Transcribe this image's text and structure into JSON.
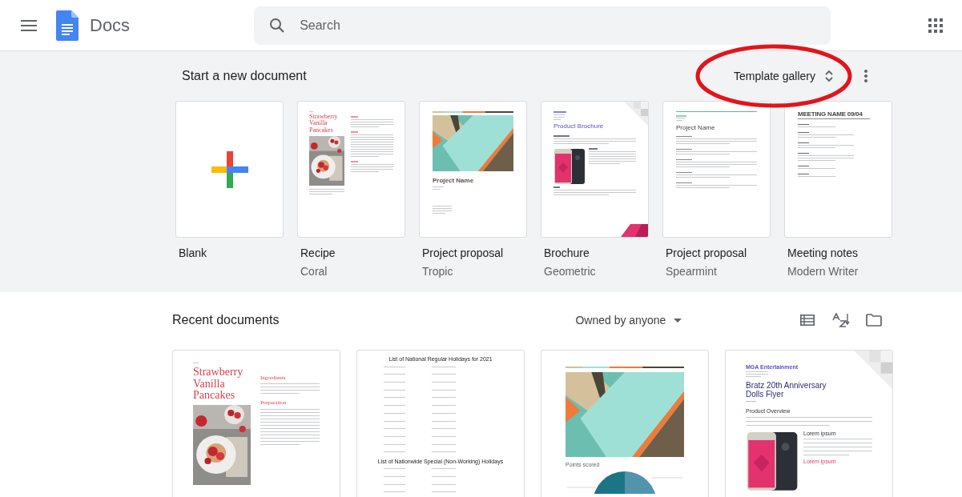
{
  "header": {
    "app_name": "Docs",
    "search": {
      "placeholder": "Search"
    }
  },
  "templates": {
    "heading": "Start a new document",
    "gallery_button": "Template gallery",
    "items": [
      {
        "kind": "blank",
        "name": "Blank"
      },
      {
        "kind": "recipe",
        "name": "Recipe",
        "theme": "Coral",
        "preview": {
          "title": "Strawberry Vanilla Pancakes"
        }
      },
      {
        "kind": "tropic",
        "name": "Project proposal",
        "theme": "Tropic",
        "preview": {
          "title": "Project Name"
        }
      },
      {
        "kind": "brochure",
        "name": "Brochure",
        "theme": "Geometric",
        "preview": {
          "title": "Product Brochure"
        }
      },
      {
        "kind": "spearmint",
        "name": "Project proposal",
        "theme": "Spearmint",
        "preview": {
          "title": "Project Name"
        }
      },
      {
        "kind": "meeting",
        "name": "Meeting notes",
        "theme": "Modern Writer",
        "preview": {
          "title": "MEETING NAME 09/04"
        }
      }
    ]
  },
  "recent": {
    "heading": "Recent documents",
    "owner_filter": "Owned by anyone",
    "documents": [
      {
        "kind": "recipe",
        "preview": {
          "title": "Strawberry Vanilla Pancakes",
          "sections": [
            "Ingredients",
            "Preparation"
          ]
        }
      },
      {
        "kind": "holidays",
        "preview": {
          "lists": [
            {
              "heading": "List of National Regular Holidays for 2021"
            },
            {
              "heading": "List of Nationwide Special (Non-Working) Holidays"
            }
          ]
        }
      },
      {
        "kind": "chart",
        "preview": {
          "caption": "Points scored"
        }
      },
      {
        "kind": "flyer",
        "preview": {
          "company": "MGA Entertainment",
          "title": "Bratz 20th Anniversary Dolls Flyer",
          "section": "Product Overview",
          "subheads": [
            "Lorem ipsum",
            "Lorem ipsum"
          ]
        }
      }
    ]
  }
}
